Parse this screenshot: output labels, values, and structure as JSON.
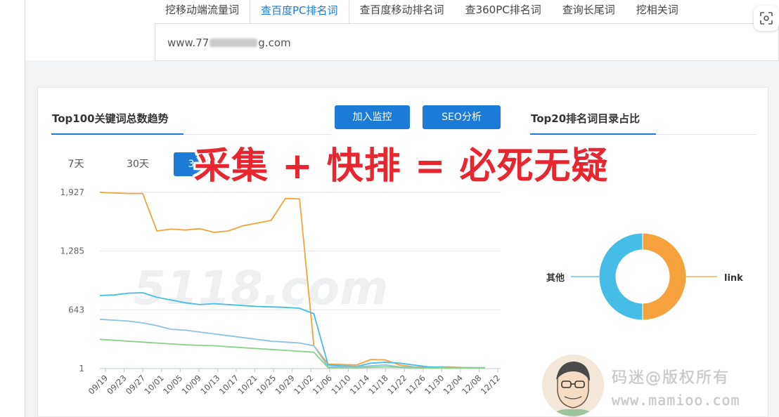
{
  "tabs": [
    {
      "label": "挖移动端流量词",
      "active": false
    },
    {
      "label": "查百度PC排名词",
      "active": true
    },
    {
      "label": "查百度移动排名词",
      "active": false
    },
    {
      "label": "查360PC排名词",
      "active": false
    },
    {
      "label": "查询长尾词",
      "active": false
    },
    {
      "label": "挖相关词",
      "active": false
    }
  ],
  "url": {
    "prefix": "www.77",
    "suffix": "g.com"
  },
  "trend": {
    "title": "Top100关键词总数趋势"
  },
  "buttons": {
    "monitor": "加入监控",
    "seo": "SEO分析"
  },
  "ranges": [
    "7天",
    "30天",
    "3"
  ],
  "directory": {
    "title": "Top20排名词目录占比"
  },
  "overlay_text": "采集 + 快排 = 必死无疑",
  "watermark_text": "5118.com",
  "copyright": {
    "line1": "码迷@版权所有",
    "line2": "www.mamioo.com"
  },
  "colors": {
    "accent": "#1d7bd8",
    "overlay_red": "#e8262f",
    "orange": "#f5a23d",
    "cyan": "#45bde6"
  },
  "chart_data": [
    {
      "type": "line",
      "title": "Top100关键词总数趋势",
      "y_ticks": [
        "1,927",
        "1,285",
        "643",
        "1"
      ],
      "ylim": [
        1,
        1927
      ],
      "x_ticks": [
        "09/19",
        "09/23",
        "09/27",
        "10/01",
        "10/05",
        "10/09",
        "10/13",
        "10/17",
        "10/21",
        "10/25",
        "10/29",
        "11/02",
        "11/06",
        "11/10",
        "11/14",
        "11/18",
        "11/22",
        "11/26",
        "11/30",
        "12/04",
        "12/08",
        "12/12"
      ],
      "series": [
        {
          "color": "#f5a23d",
          "values": [
            1927,
            1920,
            1915,
            1915,
            1505,
            1525,
            1515,
            1530,
            1490,
            1505,
            1560,
            1590,
            1620,
            1860,
            1855,
            250,
            50,
            45,
            40,
            100,
            95,
            40,
            20,
            15,
            20,
            15,
            10,
            10
          ]
        },
        {
          "color": "#45bde6",
          "values": [
            800,
            805,
            825,
            830,
            780,
            750,
            720,
            700,
            710,
            700,
            690,
            680,
            675,
            670,
            660,
            600,
            40,
            30,
            25,
            60,
            70,
            60,
            40,
            20,
            15,
            10,
            10,
            10
          ]
        },
        {
          "color": "#8fc1e0",
          "values": [
            540,
            530,
            520,
            500,
            470,
            430,
            420,
            400,
            380,
            360,
            340,
            320,
            300,
            290,
            280,
            250,
            20,
            20,
            20,
            30,
            40,
            20,
            15,
            10,
            10,
            10,
            10,
            10
          ]
        },
        {
          "color": "#8bd08b",
          "values": [
            320,
            310,
            300,
            290,
            280,
            270,
            260,
            255,
            250,
            240,
            230,
            220,
            210,
            200,
            190,
            180,
            10,
            10,
            10,
            15,
            20,
            15,
            10,
            8,
            8,
            8,
            8,
            8
          ]
        }
      ]
    },
    {
      "type": "pie",
      "title": "Top20排名词目录占比",
      "labels": [
        "其他",
        "link"
      ],
      "values": [
        50,
        50
      ],
      "colors": [
        "#45bde6",
        "#f5a23d"
      ]
    }
  ]
}
